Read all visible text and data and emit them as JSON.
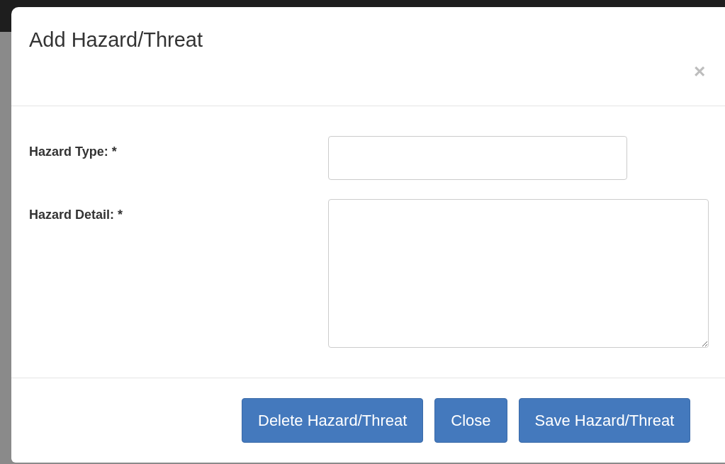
{
  "dialog": {
    "title": "Add Hazard/Threat",
    "close_glyph": "×"
  },
  "fields": [
    {
      "kind": "input",
      "label": "Hazard Type: *"
    },
    {
      "kind": "textarea",
      "label": "Hazard Detail: *"
    }
  ],
  "buttons": [
    "Delete Hazard/Threat",
    "Close",
    "Save Hazard/Threat"
  ]
}
